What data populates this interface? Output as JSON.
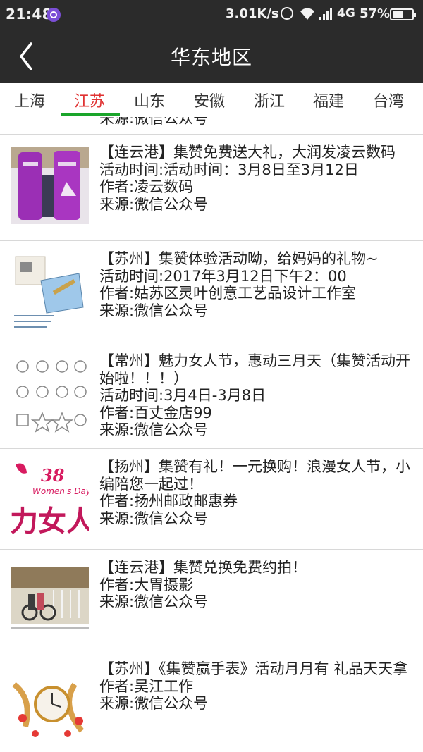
{
  "status_bar": {
    "time": "21:48",
    "speed": "3.01K/s",
    "network": "4G",
    "battery": "57%",
    "battery_level": 0.57
  },
  "nav": {
    "title": "华东地区",
    "back_icon": "chevron-left-icon"
  },
  "tabs": [
    {
      "label": "上海",
      "active": false
    },
    {
      "label": "江苏",
      "active": true
    },
    {
      "label": "山东",
      "active": false
    },
    {
      "label": "安徽",
      "active": false
    },
    {
      "label": "浙江",
      "active": false
    },
    {
      "label": "福建",
      "active": false
    },
    {
      "label": "台湾",
      "active": false
    }
  ],
  "colors": {
    "header_bg": "#2b2b2b",
    "active_tab_text": "#e03232",
    "active_tab_underline": "#1aa52a"
  },
  "list": {
    "peek_text": "来源:微信公众号",
    "items": [
      {
        "title": "【连云港】集赞免费送大礼，大润发凌云数码",
        "time": "活动时间:活动时间：3月8日至3月12日",
        "author": "作者:凌云数码",
        "source": "来源:微信公众号"
      },
      {
        "title": "【苏州】集赞体验活动呦，给妈妈的礼物~",
        "time": "活动时间:2017年3月12日下午2：00",
        "author": "作者:姑苏区灵叶创意工艺品设计工作室",
        "source": "来源:微信公众号"
      },
      {
        "title": "【常州】魅力女人节，惠动三月天（集赞活动开始啦！！！）",
        "time": "活动时间:3月4日-3月8日",
        "author": "作者:百丈金店99",
        "source": "来源:微信公众号"
      },
      {
        "title": "【扬州】集赞有礼！一元换购！浪漫女人节，小编陪您一起过！",
        "author": "作者:扬州邮政邮惠券",
        "source": "来源:微信公众号",
        "thumb_text_top": "38",
        "thumb_text_mid": "Women's Day",
        "thumb_text_big": "力女人"
      },
      {
        "title": "【连云港】集赞兑换免费约拍！",
        "author": "作者:大胃摄影",
        "source": "来源:微信公众号"
      },
      {
        "title": "【苏州】《集赞赢手表》活动月月有 礼品天天拿",
        "author": "作者:吴江工作",
        "source": "来源:微信公众号"
      }
    ]
  }
}
